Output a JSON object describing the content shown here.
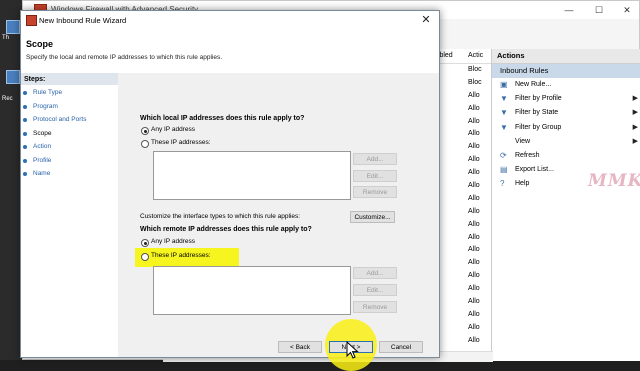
{
  "desktop": {
    "icon_label_1": "Th",
    "icon_label_2": "Rec"
  },
  "main_window": {
    "title": "Windows Firewall with Advanced Security",
    "controls": {
      "minimize": "—",
      "maximize": "☐",
      "close": "✕"
    },
    "grid": {
      "header_1": "iabled",
      "header_2": "Actic",
      "rows": [
        "Bloc",
        "Bloc",
        "Allo",
        "Allo",
        "Allo",
        "Allo",
        "Allo",
        "Allo",
        "Allo",
        "Allo",
        "Allo",
        "Allo",
        "Allo",
        "Allo",
        "Allo",
        "Allo",
        "Allo",
        "Allo",
        "Allo",
        "Allo",
        "Allo",
        "Allo"
      ]
    },
    "actions": {
      "title": "Actions",
      "group": "Inbound Rules",
      "items": [
        {
          "label": "New Rule...",
          "icon": "new-rule-icon",
          "glyph": "▣",
          "submenu": false
        },
        {
          "label": "Filter by Profile",
          "icon": "filter-icon",
          "glyph": "▼",
          "submenu": true
        },
        {
          "label": "Filter by State",
          "icon": "filter-icon",
          "glyph": "▼",
          "submenu": true
        },
        {
          "label": "Filter by Group",
          "icon": "filter-icon",
          "glyph": "▼",
          "submenu": true
        },
        {
          "label": "View",
          "icon": "",
          "glyph": "",
          "submenu": true
        },
        {
          "label": "Refresh",
          "icon": "refresh-icon",
          "glyph": "⟳",
          "submenu": false
        },
        {
          "label": "Export List...",
          "icon": "export-icon",
          "glyph": "▤",
          "submenu": false
        },
        {
          "label": "Help",
          "icon": "help-icon",
          "glyph": "?",
          "submenu": false
        }
      ]
    },
    "watermark": "MMK"
  },
  "wizard": {
    "title": "New Inbound Rule Wizard",
    "close": "✕",
    "heading": "Scope",
    "subheading": "Specify the local and remote IP addresses to which this rule applies.",
    "steps_header": "Steps:",
    "steps": [
      "Rule Type",
      "Program",
      "Protocol and Ports",
      "Scope",
      "Action",
      "Profile",
      "Name"
    ],
    "active_step": 3,
    "local": {
      "question": "Which local IP addresses does this rule apply to?",
      "any": "Any IP address",
      "these": "These IP addresses:",
      "add": "Add...",
      "edit": "Edit...",
      "remove": "Remove"
    },
    "interface_text": "Customize the interface types to which this rule applies:",
    "customize": "Customize...",
    "remote": {
      "question": "Which remote IP addresses does this rule apply to?",
      "any": "Any IP address",
      "these": "These IP addresses:",
      "add": "Add...",
      "edit": "Edit...",
      "remove": "Remove"
    },
    "back": "< Back",
    "next": "Next >",
    "cancel": "Cancel"
  },
  "colors": {
    "highlight": "#f6f51f",
    "link": "#2a62a9",
    "selected_group": "#c9d9ea"
  }
}
